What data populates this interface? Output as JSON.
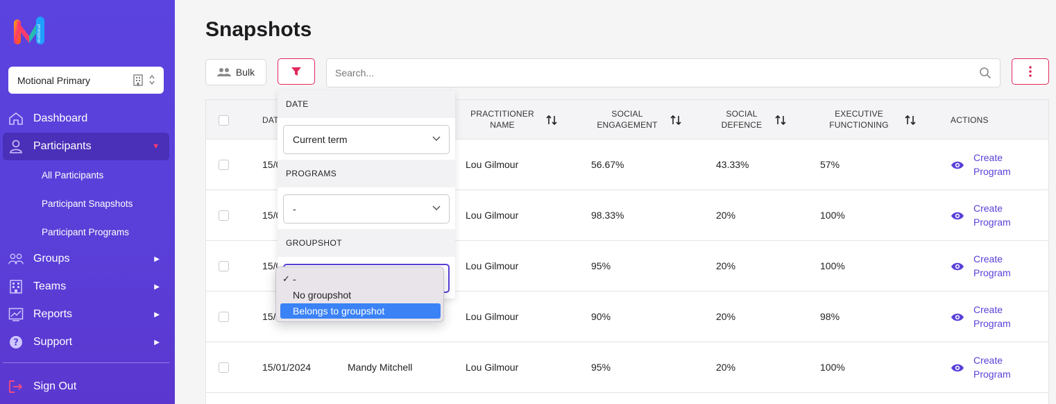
{
  "brand": {
    "logo_text": "motional",
    "colors": {
      "primary": "#5a3fd8",
      "accent": "#e0285a",
      "highlight": "#3a82f6"
    }
  },
  "sidebar": {
    "org_select": {
      "value": "Motional Primary",
      "icon": "building-icon"
    },
    "items": [
      {
        "label": "Dashboard",
        "icon": "home-icon"
      },
      {
        "label": "Participants",
        "icon": "user-icon",
        "expanded": true
      },
      {
        "label": "Groups",
        "icon": "group-icon"
      },
      {
        "label": "Teams",
        "icon": "building-icon"
      },
      {
        "label": "Reports",
        "icon": "chart-icon"
      },
      {
        "label": "Support",
        "icon": "help-icon"
      }
    ],
    "sub_items": [
      "All Participants",
      "Participant Snapshots",
      "Participant Programs"
    ],
    "sign_out": "Sign Out"
  },
  "header": {
    "title": "Snapshots"
  },
  "toolbar": {
    "bulk_label": "Bulk",
    "search_placeholder": "Search..."
  },
  "table": {
    "headers": {
      "date": "DAT",
      "practitioner": [
        "PRACTITIONER",
        "NAME"
      ],
      "social_engagement": [
        "SOCIAL",
        "ENGAGEMENT"
      ],
      "social_defence": [
        "SOCIAL",
        "DEFENCE"
      ],
      "executive_functioning": [
        "EXECUTIVE",
        "FUNCTIONING"
      ],
      "actions": "ACTIONS"
    },
    "rows": [
      {
        "date": "15/0",
        "participant": "",
        "practitioner": "Lou Gilmour",
        "se": "56.67%",
        "sd": "43.33%",
        "ef": "57%",
        "action": [
          "Create",
          "Program"
        ]
      },
      {
        "date": "15/0",
        "participant": "",
        "practitioner": "Lou Gilmour",
        "se": "98.33%",
        "sd": "20%",
        "ef": "100%",
        "action": [
          "Create",
          "Program"
        ]
      },
      {
        "date": "15/0",
        "participant": "",
        "practitioner": "Lou Gilmour",
        "se": "95%",
        "sd": "20%",
        "ef": "100%",
        "action": [
          "Create",
          "Program"
        ]
      },
      {
        "date": "15/",
        "participant": "",
        "practitioner": "Lou Gilmour",
        "se": "90%",
        "sd": "20%",
        "ef": "98%",
        "action": [
          "Create",
          "Program"
        ]
      },
      {
        "date": "15/01/2024",
        "participant": "Mandy Mitchell",
        "practitioner": "Lou Gilmour",
        "se": "95%",
        "sd": "20%",
        "ef": "100%",
        "action": [
          "Create",
          "Program"
        ]
      }
    ]
  },
  "filter": {
    "date_label": "DATE",
    "date_value": "Current term",
    "programs_label": "PROGRAMS",
    "programs_value": "-",
    "groupshot_label": "GROUPSHOT",
    "groupshot_options": [
      "-",
      "No groupshot",
      "Belongs to groupshot"
    ],
    "groupshot_checked": "-",
    "groupshot_highlighted": "Belongs to groupshot"
  }
}
